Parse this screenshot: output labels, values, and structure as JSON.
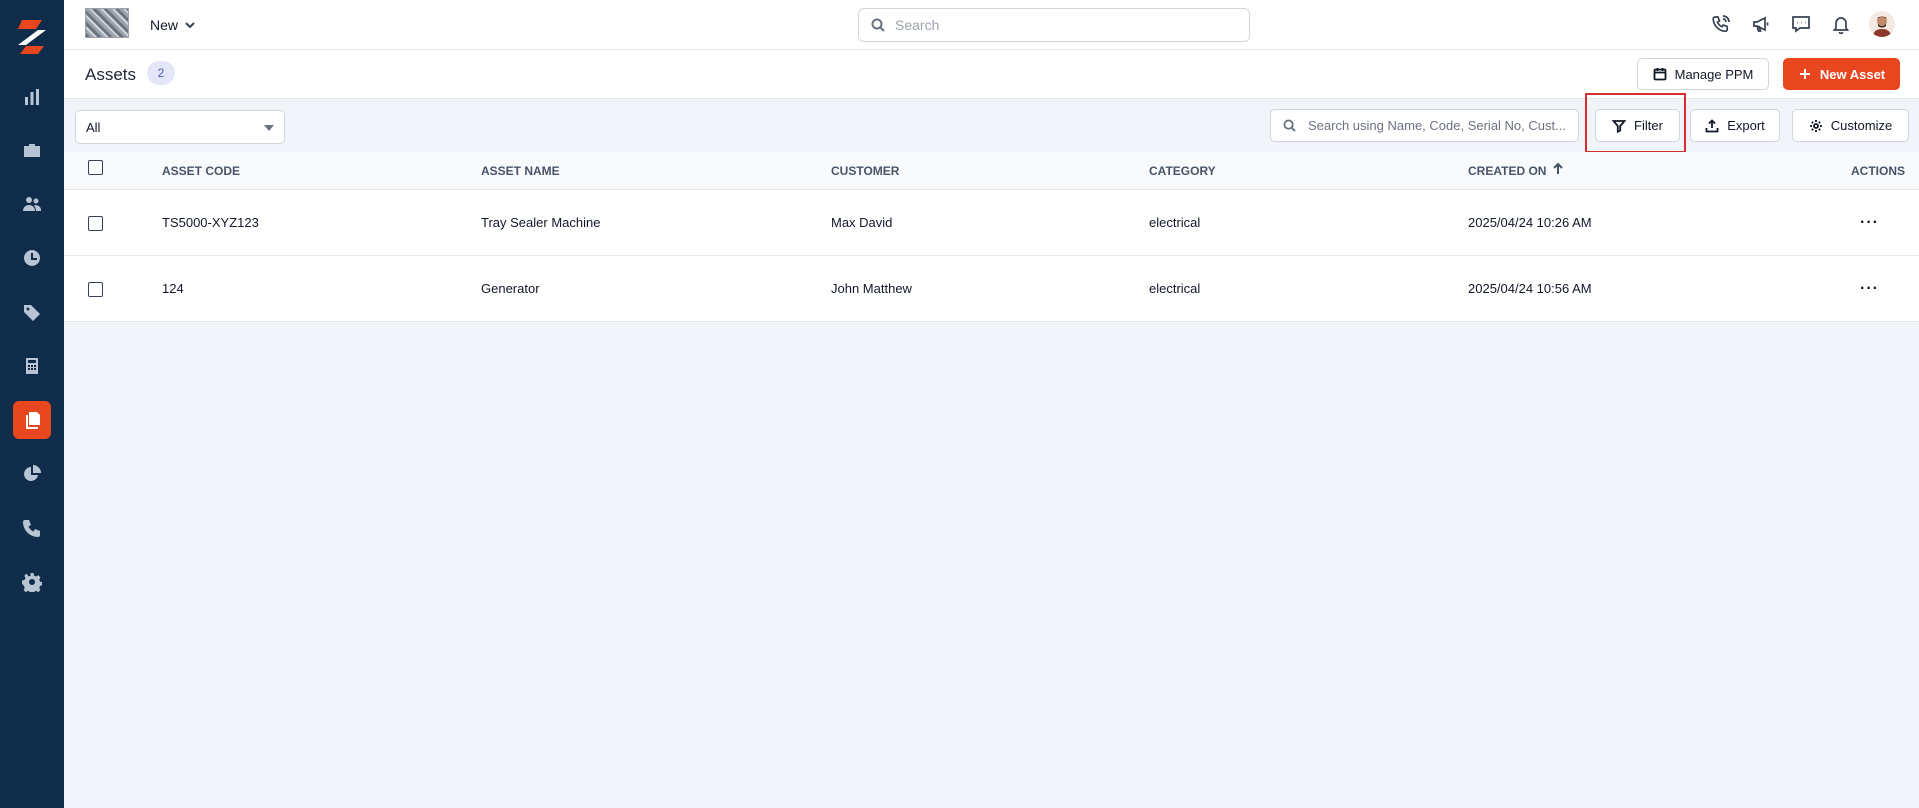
{
  "header": {
    "workspace_label": "New",
    "search_placeholder": "Search"
  },
  "page": {
    "title": "Assets",
    "count": "2",
    "manage_ppm_label": "Manage PPM",
    "new_asset_label": "New Asset"
  },
  "toolbar": {
    "view_select_value": "All",
    "search_placeholder": "Search using Name, Code, Serial No, Cust...",
    "filter_label": "Filter",
    "export_label": "Export",
    "customize_label": "Customize"
  },
  "table": {
    "columns": [
      "ASSET CODE",
      "ASSET NAME",
      "CUSTOMER",
      "CATEGORY",
      "CREATED ON",
      "ACTIONS"
    ],
    "rows": [
      {
        "code": "TS5000-XYZ123",
        "name": "Tray Sealer Machine",
        "customer": "Max David",
        "category": "electrical",
        "created_on": "2025/04/24 10:26 AM",
        "actions": "···"
      },
      {
        "code": "124",
        "name": "Generator",
        "customer": "John Matthew",
        "category": "electrical",
        "created_on": "2025/04/24 10:56 AM",
        "actions": "···"
      }
    ]
  },
  "colors": {
    "sidebar_bg": "#0f2d4a",
    "accent": "#e8461e",
    "highlight": "#d32f2f"
  },
  "icons": {
    "sidebar": [
      "dashboard-icon",
      "jobs-briefcase-icon",
      "customers-icon",
      "timesheet-clock-icon",
      "pricebook-tag-icon",
      "invoice-calculator-icon",
      "assets-icon",
      "reports-pie-icon",
      "calls-phone-icon",
      "settings-gear-icon"
    ],
    "topbar": [
      "phone-call-icon",
      "megaphone-icon",
      "chat-icon",
      "bell-icon",
      "user-avatar"
    ]
  }
}
